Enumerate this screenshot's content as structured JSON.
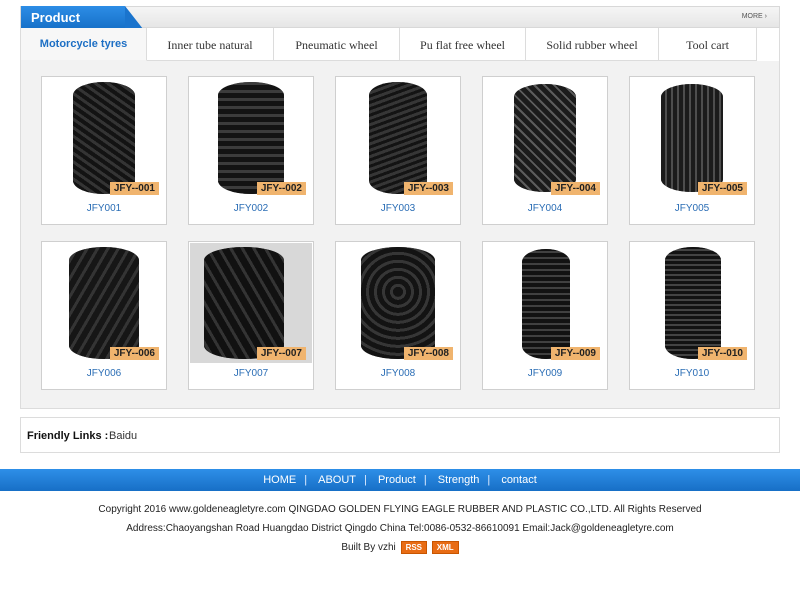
{
  "header": {
    "title": "Product",
    "more": "MORE ›"
  },
  "tabs": [
    "Motorcycle tyres",
    "Inner tube natural",
    "Pneumatic wheel",
    "Pu flat free wheel",
    "Solid rubber wheel",
    "Tool cart"
  ],
  "products": [
    {
      "name": "JFY001",
      "tag": "JFY--001"
    },
    {
      "name": "JFY002",
      "tag": "JFY--002"
    },
    {
      "name": "JFY003",
      "tag": "JFY--003"
    },
    {
      "name": "JFY004",
      "tag": "JFY--004"
    },
    {
      "name": "JFY005",
      "tag": "JFY--005"
    },
    {
      "name": "JFY006",
      "tag": "JFY--006"
    },
    {
      "name": "JFY007",
      "tag": "JFY--007"
    },
    {
      "name": "JFY008",
      "tag": "JFY--008"
    },
    {
      "name": "JFY009",
      "tag": "JFY--009"
    },
    {
      "name": "JFY010",
      "tag": "JFY--010"
    }
  ],
  "friendly_links": {
    "label": "Friendly Links :",
    "items": [
      "Baidu"
    ]
  },
  "nav": [
    "HOME",
    "ABOUT",
    "Product",
    "Strength",
    "contact"
  ],
  "footer": {
    "copyright": "Copyright 2016 www.goldeneagletyre.com QINGDAO GOLDEN FLYING EAGLE RUBBER AND PLASTIC CO.,LTD. All Rights Reserved",
    "address": "Address:Chaoyangshan Road Huangdao District Qingdo China Tel:0086-0532-86610091 Email:Jack@goldeneagletyre.com",
    "built_by": "Built By vzhi",
    "rss": "RSS",
    "xml": "XML"
  },
  "colors": {
    "accent": "#1d6fc4",
    "tag": "#f0b46e",
    "badge": "#e86c14"
  }
}
